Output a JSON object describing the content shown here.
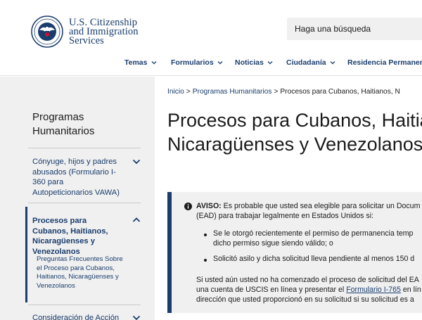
{
  "header": {
    "logo": {
      "line1": "U.S. Citizenship",
      "line2": "and Immigration",
      "line3": "Services"
    },
    "search": {
      "placeholder": "Haga una búsqueda"
    },
    "nav": [
      {
        "label": "Temas"
      },
      {
        "label": "Formularios"
      },
      {
        "label": "Noticias"
      },
      {
        "label": "Ciudadanía"
      },
      {
        "label": "Residencia Permanent"
      }
    ]
  },
  "sidebar": {
    "title": "Programas Humanitarios",
    "items": [
      {
        "label": "Cónyuge, hijos y padres abusados (Formulario I-360 para Autopeticionarios VAWA)"
      },
      {
        "label": "Procesos para Cubanos, Haitianos, Nicaragüenses y Venezolanos"
      },
      {
        "label": "Consideración de Acción"
      }
    ],
    "subitem": "Preguntas Frecuentes Sobre el Proceso para Cubanos, Haitianos, Nicaragüenses y Venezolanos"
  },
  "breadcrumb": {
    "home": "Inicio",
    "section": "Programas Humanitarios",
    "current": "Procesos para Cubanos, Haitianos, N"
  },
  "main": {
    "title_line1": "Procesos para Cubanos, Haitia",
    "title_line2": "Nicaragüenses y Venezolanos"
  },
  "alert": {
    "label": "AVISO:",
    "line1": "Es probable que usted sea elegible para solicitar un Docum",
    "line2": "(EAD) para trabajar legalmente en Estados Unidos si:",
    "bullet1_a": "Se le otorgó recientemente el permiso de permanencia temp",
    "bullet1_b": "dicho permiso sigue siendo válido; o",
    "bullet2": "Solicitó asilo y dicha solicitud lleva pendiente al menos 150 d",
    "para_a": "Si usted aún usted no ha comenzado el proceso de solicitud del EA",
    "para_b1": "una cuenta de USCIS en línea y presentar el ",
    "para_b_link": "Formulario I-765",
    "para_b2": " en lín",
    "para_c": "dirección que usted proporcionó en su solicitud si su solicitud es a"
  }
}
